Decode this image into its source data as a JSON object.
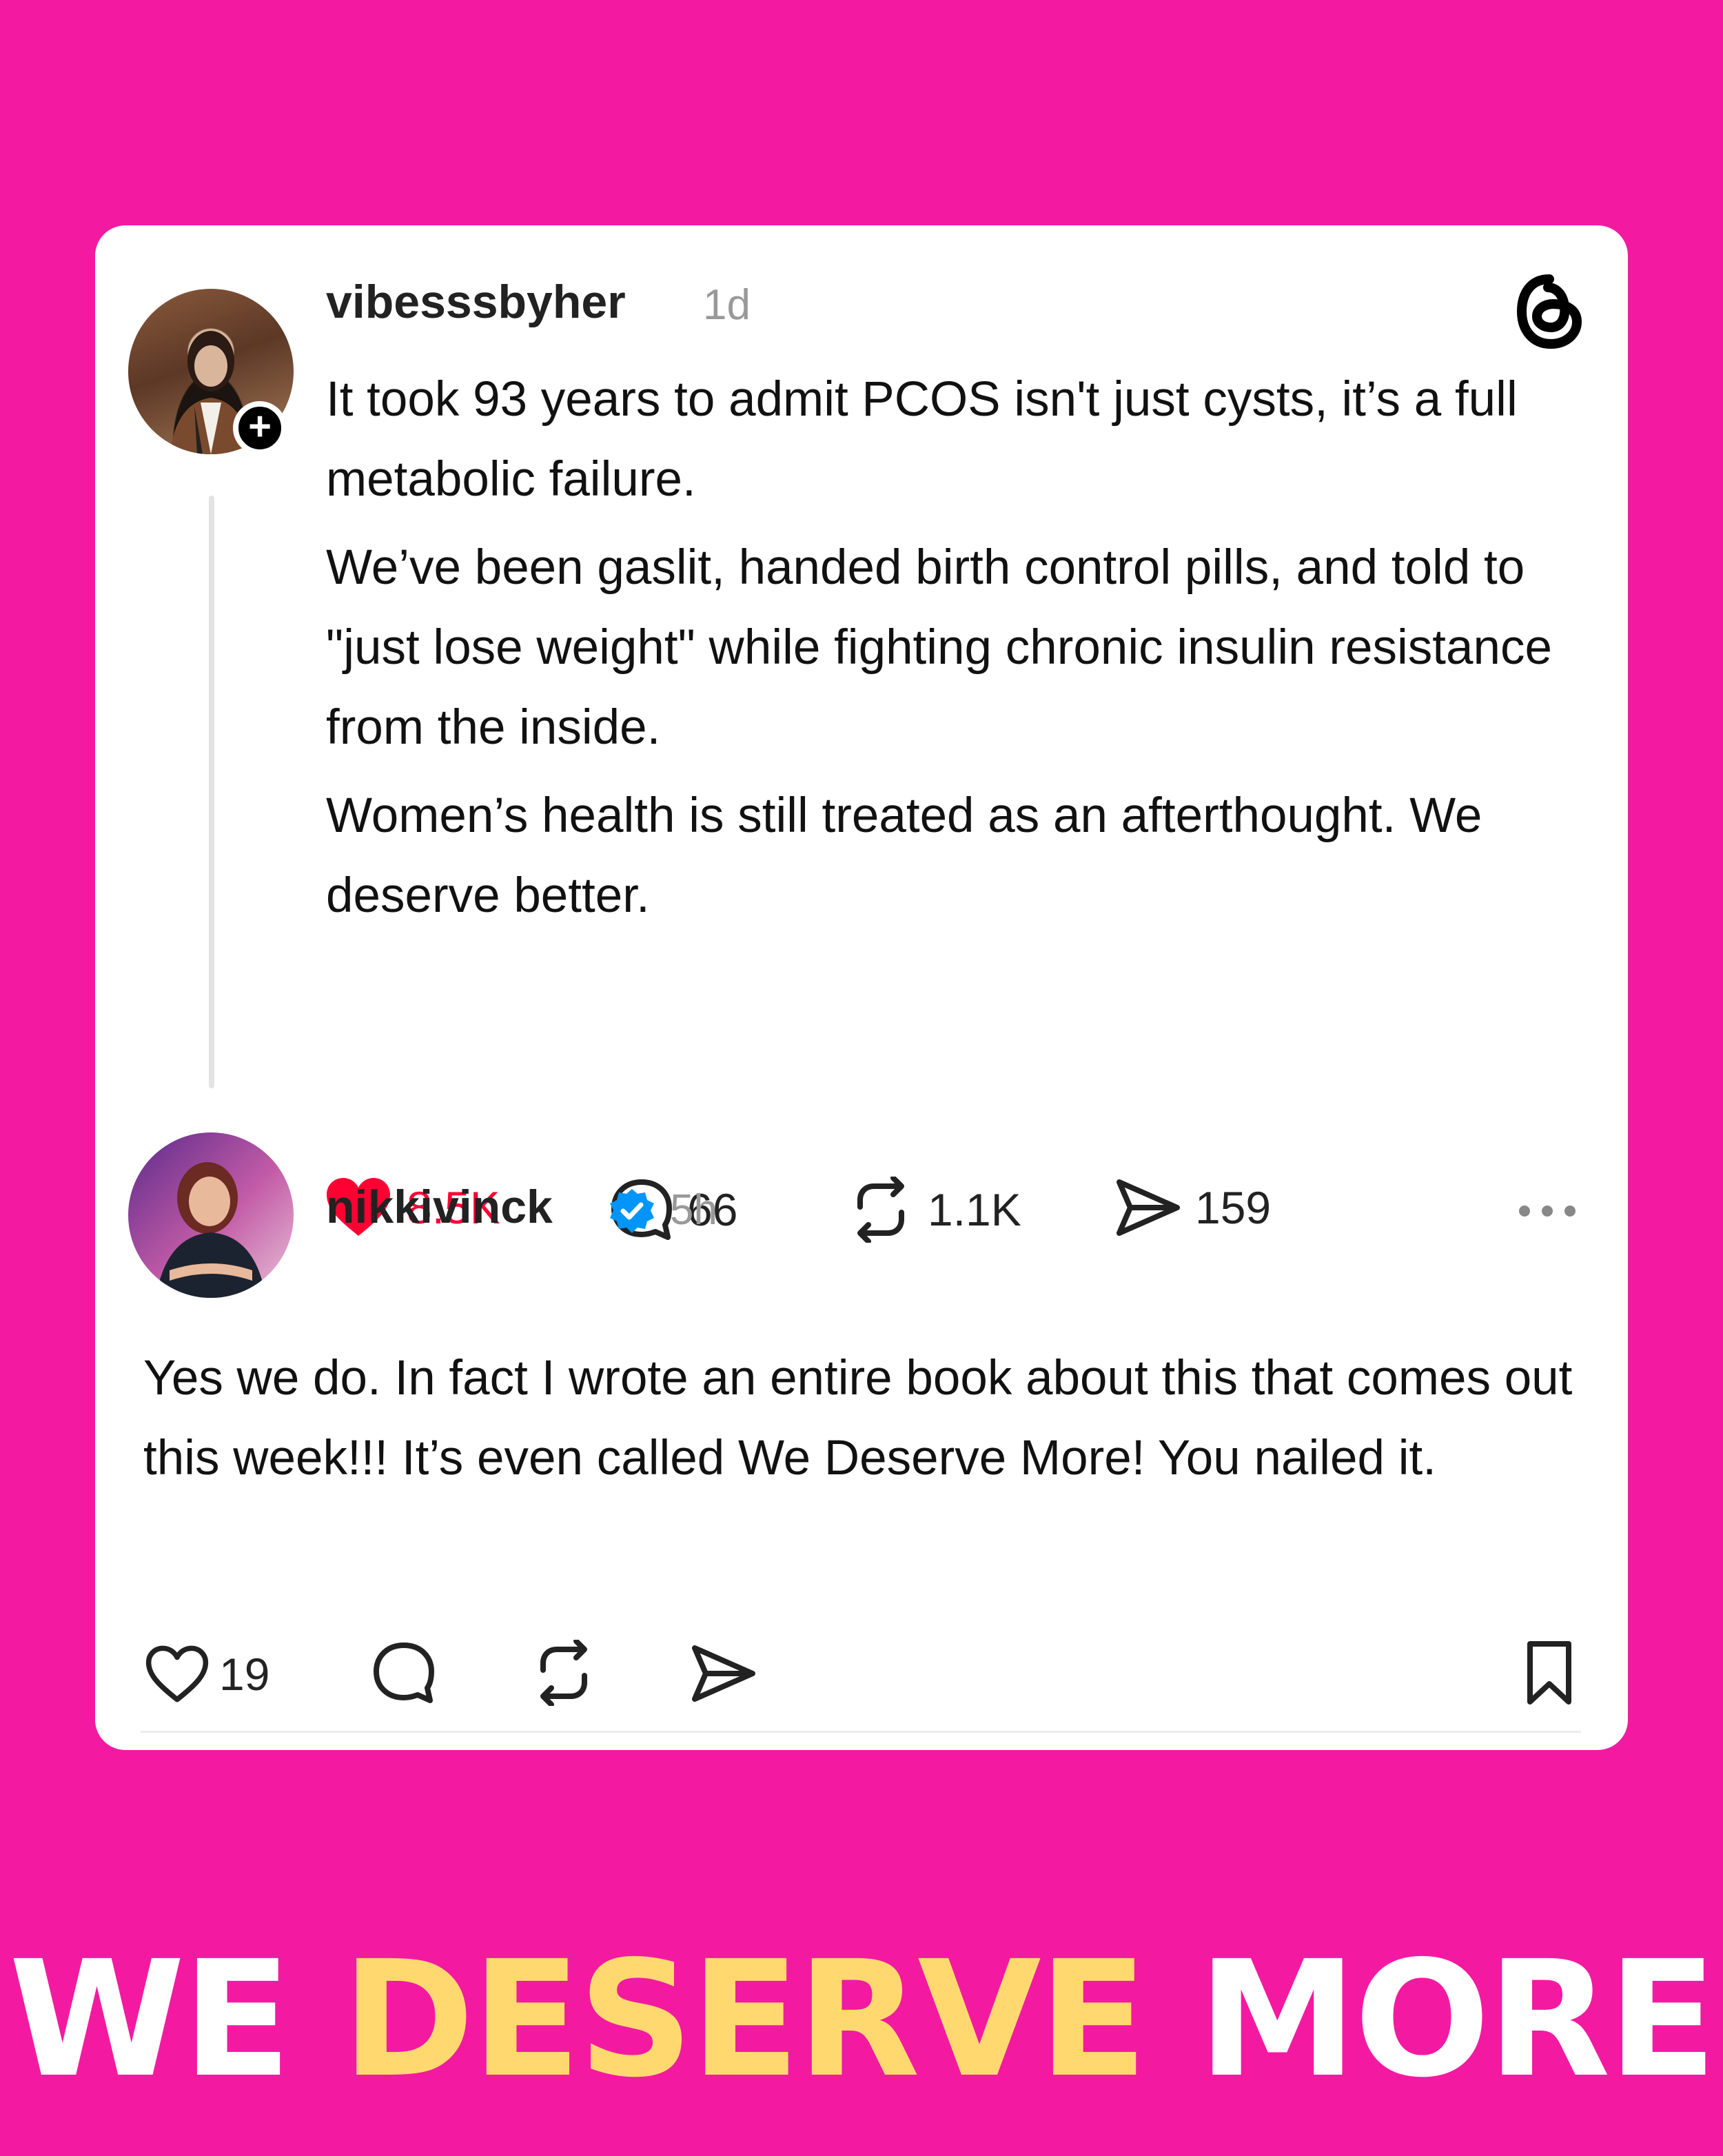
{
  "colors": {
    "background": "#f31aa1",
    "card": "#ffffff",
    "like_red": "#ff0033",
    "verified_blue": "#0095f6",
    "banner_white": "#ffffff",
    "banner_yellow": "#ffd970"
  },
  "post": {
    "username": "vibesssbyher",
    "time": "1d",
    "avatar_icon": "profile-photo",
    "follow_icon": "plus-icon",
    "app_icon": "threads-logo-icon",
    "paragraphs": [
      "It took 93 years to admit PCOS isn't just cysts, it’s a full metabolic failure.",
      "We’ve been gaslit, handed birth control pills, and told to \"just lose weight\" while fighting chronic insulin resistance from the inside.",
      "Women’s health is still treated as an afterthought. We deserve better."
    ],
    "likes": "8.5K",
    "comments": "66",
    "reposts": "1.1K",
    "shares": "159"
  },
  "reply": {
    "username": "nikkivinck",
    "verified_icon": "verified-badge-icon",
    "time": "5h",
    "more_icon": "more-options-icon",
    "text": "Yes we do. In fact I wrote an entire book about this that comes out this week!!! It’s even called We Deserve More! You nailed it.",
    "likes": "19"
  },
  "banner": {
    "word1": "WE",
    "word2": "DESERVE",
    "word3": "MORE"
  }
}
